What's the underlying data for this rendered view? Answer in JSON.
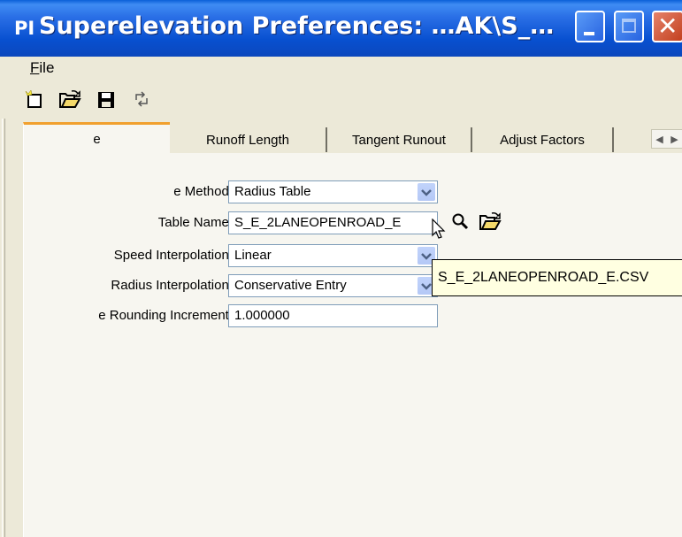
{
  "window": {
    "title": "Superelevation Preferences: …AK\\S_…",
    "app_icon": "PI"
  },
  "menu": {
    "file": "File"
  },
  "toolbar": {
    "icons": [
      "new-icon",
      "open-folder-icon",
      "save-icon",
      "reload-icon"
    ]
  },
  "tabs": {
    "active": "e",
    "items": [
      "Runoff Length",
      "Tangent Runout",
      "Adjust Factors"
    ]
  },
  "form": {
    "e_method": {
      "label": "e Method:",
      "value": "Radius Table"
    },
    "table_name": {
      "label": "Table Name:",
      "value": "S_E_2LANEOPENROAD_E"
    },
    "speed_interp": {
      "label": "Speed Interpolation:",
      "value": "Linear"
    },
    "radius_interp": {
      "label": "Radius Interpolation:",
      "value": "Conservative Entry"
    },
    "rounding": {
      "label": "e Rounding Increment:",
      "value": "1.000000"
    }
  },
  "tooltip": {
    "text": "S_E_2LANEOPENROAD_E.CSV"
  },
  "colors": {
    "title_bar": "#0850D0",
    "dialog_bg": "#ECE9D8",
    "panel_bg": "#F7F6F0",
    "tab_highlight": "#F1A02E",
    "tooltip_bg": "#FFFFE1"
  }
}
